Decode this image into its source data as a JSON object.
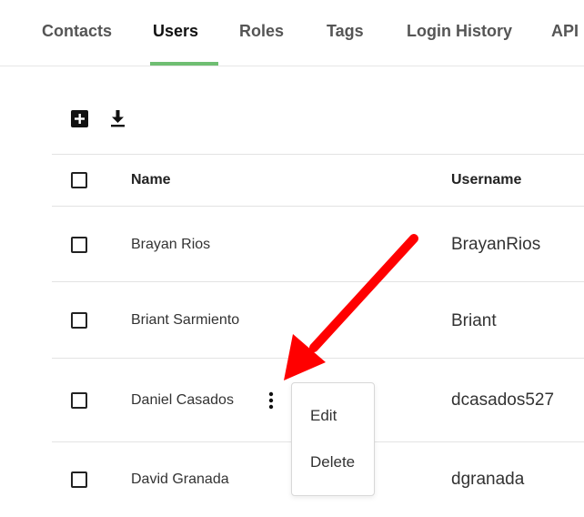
{
  "tabs": [
    {
      "label": "Contacts",
      "active": false
    },
    {
      "label": "Users",
      "active": true
    },
    {
      "label": "Roles",
      "active": false
    },
    {
      "label": "Tags",
      "active": false
    },
    {
      "label": "Login History",
      "active": false
    },
    {
      "label": "API",
      "active": false
    }
  ],
  "toolbar": {
    "add_icon": "add-box-icon",
    "download_icon": "download-icon"
  },
  "table": {
    "headers": {
      "name": "Name",
      "username": "Username"
    },
    "rows": [
      {
        "name": "Brayan Rios",
        "username": "BrayanRios"
      },
      {
        "name": "Briant Sarmiento",
        "username": "Briant"
      },
      {
        "name": "Daniel Casados",
        "username": "dcasados527"
      },
      {
        "name": "David Granada",
        "username": "dgranada"
      }
    ]
  },
  "context_menu": {
    "items": [
      "Edit",
      "Delete"
    ]
  },
  "colors": {
    "active_tab_underline": "#6fbe72",
    "annotation_arrow": "#ff0000"
  }
}
